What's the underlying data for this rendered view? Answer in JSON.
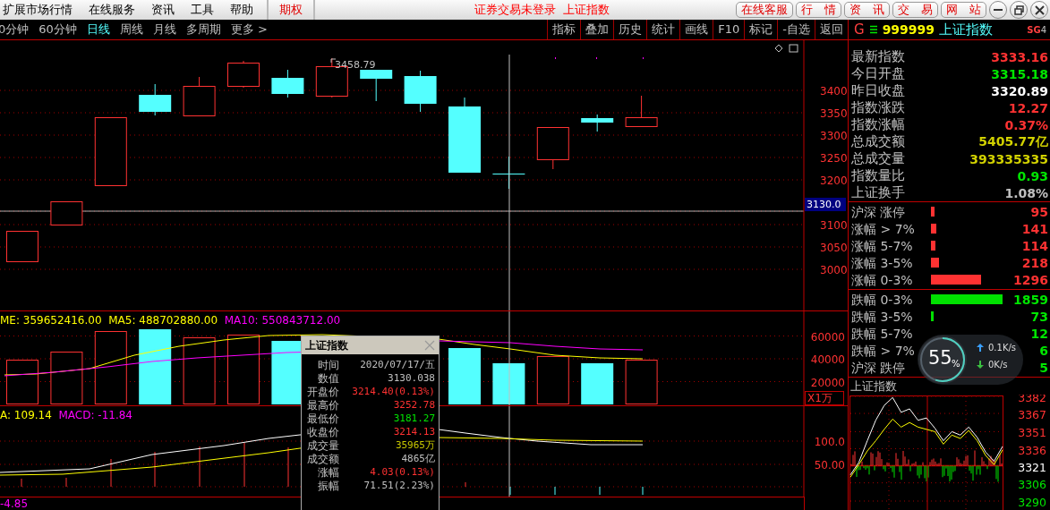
{
  "menu_bar": {
    "items": [
      {
        "label": "扩展市场行情",
        "kind": "menu"
      },
      {
        "label": "在线服务",
        "kind": "menu"
      },
      {
        "label": "资讯",
        "kind": "menu"
      },
      {
        "label": "工具",
        "kind": "menu"
      },
      {
        "label": "帮助",
        "kind": "menu"
      },
      {
        "label": "期权",
        "kind": "highlight"
      }
    ],
    "status": "证券交易未登录  上证指数",
    "buttons": [
      "在线客服",
      "行　情",
      "资　讯",
      "交　易",
      "网　站"
    ]
  },
  "period_tabs": [
    {
      "label": "0分钟",
      "selected": false
    },
    {
      "label": "60分钟",
      "selected": false
    },
    {
      "label": "日线",
      "selected": true
    },
    {
      "label": "周线",
      "selected": false
    },
    {
      "label": "月线",
      "selected": false
    },
    {
      "label": "多周期",
      "selected": false
    },
    {
      "label": "更多 >",
      "selected": false
    }
  ],
  "tool_buttons": [
    "指标",
    "叠加",
    "历史",
    "统计",
    "画线",
    "F10",
    "标记",
    "-自选",
    "返回"
  ],
  "quote_header": {
    "market": "G",
    "code": "999999",
    "name": "上证指数",
    "badge": "SG",
    "badge_number": "4"
  },
  "price_chart": {
    "axis_labels": [
      "3400",
      "3350",
      "3300",
      "3250",
      "3200",
      "3100",
      "3050",
      "3000"
    ],
    "high_label": "3458.79",
    "cursor_label": "3130.0"
  },
  "volume_chart": {
    "legend": [
      {
        "text": "ME: 359652416.00",
        "color": "#ffff00"
      },
      {
        "text": "MA5: 488702880.00",
        "color": "#ffff00"
      },
      {
        "text": "MA10: 550843712.00",
        "color": "#ff00ff"
      }
    ],
    "axis_labels": [
      "60000",
      "40000",
      "20000"
    ],
    "unit": "X1万"
  },
  "macd_chart": {
    "legend": [
      {
        "text": "A: 109.14",
        "color": "#ffff00"
      },
      {
        "text": "MACD: -11.84",
        "color": "#ff00ff"
      }
    ],
    "axis_labels": [
      "100.0",
      "50.00"
    ]
  },
  "bottom_pane": {
    "legend": "-4.85"
  },
  "popup": {
    "title": "上证指数",
    "rows": [
      {
        "label": "时间",
        "value": "2020/07/17/五",
        "color": "#c0c0c0"
      },
      {
        "label": "数值",
        "value": "3130.038",
        "color": "#c0c0c0"
      },
      {
        "label": "开盘价",
        "value": "3214.40(0.13%)",
        "color": "#ff3232"
      },
      {
        "label": "最高价",
        "value": "3252.78",
        "color": "#ff3232"
      },
      {
        "label": "最低价",
        "value": "3181.27",
        "color": "#00e600"
      },
      {
        "label": "收盘价",
        "value": "3214.13",
        "color": "#ff3232"
      },
      {
        "label": "成交量",
        "value": "35965万",
        "color": "#c8c800"
      },
      {
        "label": "成交额",
        "value": "4865亿",
        "color": "#c0c0c0"
      },
      {
        "label": "涨幅",
        "value": "4.03(0.13%)",
        "color": "#ff3232"
      },
      {
        "label": "振幅",
        "value": "71.51(2.23%)",
        "color": "#c0c0c0"
      }
    ]
  },
  "stats": [
    {
      "label": "最新指数",
      "value": "3333.16",
      "color": "#ff3232"
    },
    {
      "label": "今日开盘",
      "value": "3315.18",
      "color": "#00e600"
    },
    {
      "label": "昨日收盘",
      "value": "3320.89",
      "color": "#ffffff"
    },
    {
      "label": "指数涨跌",
      "value": "12.27",
      "color": "#ff3232"
    },
    {
      "label": "指数涨幅",
      "value": "0.37%",
      "color": "#ff3232"
    },
    {
      "label": "总成交额",
      "value": "5405.77亿",
      "color": "#d2d200"
    },
    {
      "label": "总成交量",
      "value": "393335335",
      "color": "#d2d200"
    },
    {
      "label": "指数量比",
      "value": "0.93",
      "color": "#00e600"
    },
    {
      "label": "上证换手",
      "value": "1.08%",
      "color": "#c0c0c0"
    }
  ],
  "breadth_up": [
    {
      "label": "沪深 涨停",
      "value": "95"
    },
    {
      "label": "涨幅 > 7%",
      "value": "141"
    },
    {
      "label": "涨幅 5-7%",
      "value": "114"
    },
    {
      "label": "涨幅 3-5%",
      "value": "218"
    },
    {
      "label": "涨幅 0-3%",
      "value": "1296"
    }
  ],
  "breadth_down": [
    {
      "label": "跌幅 0-3%",
      "value": "1859"
    },
    {
      "label": "跌幅 3-5%",
      "value": "73"
    },
    {
      "label": "跌幅 5-7%",
      "value": "12"
    },
    {
      "label": "跌幅 > 7%",
      "value": "6"
    },
    {
      "label": "沪深 跌停",
      "value": "5"
    }
  ],
  "network_widget": {
    "percent": "55",
    "unit": "%",
    "upload": "0.1K/s",
    "download": "0K/s"
  },
  "intraday": {
    "title": "上证指数",
    "chart_data": {
      "type": "line",
      "categories": [
        null,
        null,
        null,
        null,
        null,
        null,
        null,
        null,
        null,
        null,
        null,
        null,
        null,
        null,
        null,
        null,
        null,
        null,
        null
      ],
      "ylim": [
        3290,
        3382
      ],
      "yticks": [
        3382,
        3367,
        3351,
        3336,
        3321,
        3306,
        3290
      ],
      "grid": true,
      "series": [
        {
          "color": "#ffffff",
          "values": [
            3313,
            3324,
            3343,
            3361,
            3374,
            3381,
            3368,
            3371,
            3361,
            3363,
            3354,
            3343,
            3351,
            3348,
            3355,
            3346,
            3333,
            3325,
            3338
          ]
        },
        {
          "color": "#ffff00",
          "values": [
            3311,
            3322,
            3334,
            3343,
            3353,
            3362,
            3355,
            3359,
            3355,
            3353,
            3351,
            3340,
            3348,
            3345,
            3352,
            3343,
            3330,
            3322,
            3335
          ]
        }
      ]
    }
  }
}
